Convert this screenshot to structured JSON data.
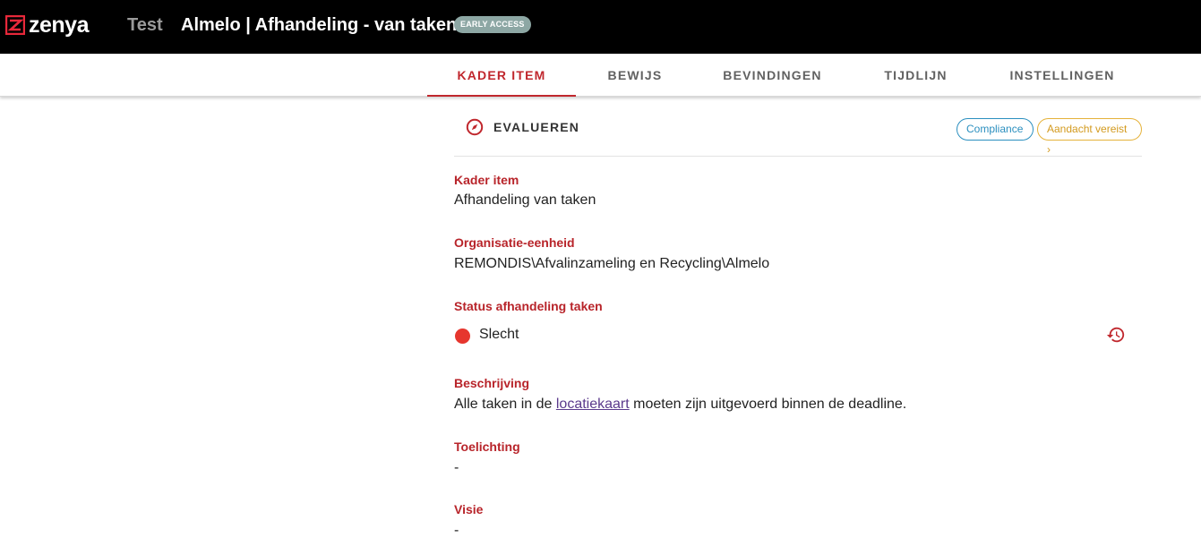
{
  "header": {
    "logo_text": "zenya",
    "environment": "Test",
    "title": "Almelo | Afhandeling - van taken",
    "badge": "EARLY ACCESS"
  },
  "tabs": [
    {
      "label": "KADER ITEM",
      "active": true
    },
    {
      "label": "BEWIJS",
      "active": false
    },
    {
      "label": "BEVINDINGEN",
      "active": false
    },
    {
      "label": "TIJDLIJN",
      "active": false
    },
    {
      "label": "INSTELLINGEN",
      "active": false
    }
  ],
  "section": {
    "title": "EVALUEREN",
    "icon": "compass-icon",
    "chips": {
      "compliance": "Compliance",
      "attention": "Aandacht vereist ›"
    }
  },
  "fields": {
    "kader_item": {
      "label": "Kader item",
      "value": "Afhandeling van taken"
    },
    "organisatie": {
      "label": "Organisatie-eenheid",
      "value": "REMONDIS\\Afvalinzameling en Recycling\\Almelo"
    },
    "status": {
      "label": "Status afhandeling taken",
      "value": "Slecht",
      "color": "#e6362e"
    },
    "beschrijving": {
      "label": "Beschrijving",
      "before": "Alle taken in de ",
      "link": "locatiekaart",
      "after": " moeten zijn uitgevoerd binnen de deadline."
    },
    "toelichting": {
      "label": "Toelichting",
      "value": "-"
    },
    "visie": {
      "label": "Visie",
      "value": "-"
    }
  },
  "colors": {
    "accent": "#c0272d",
    "header_bg": "#000000",
    "compliance": "#2b8fbf",
    "attention": "#d39a1e"
  }
}
